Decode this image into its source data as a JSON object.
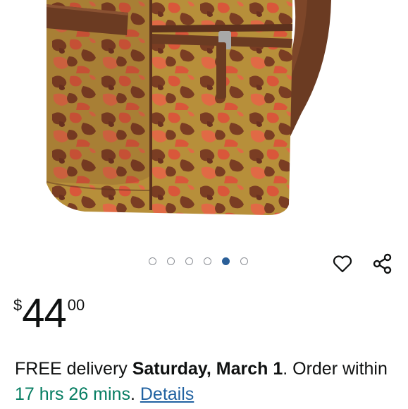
{
  "product": {
    "image_alt": "Leopard print backpack close-up",
    "carousel": {
      "count": 6,
      "active_index": 4
    }
  },
  "actions": {
    "favorite_icon": "heart-outline-icon",
    "share_icon": "share-icon"
  },
  "price": {
    "symbol": "$",
    "whole": "44",
    "fraction": "00"
  },
  "delivery": {
    "prefix": "FREE delivery ",
    "date": "Saturday, March 1",
    "middle": ". Order within ",
    "countdown": "17 hrs 26 mins",
    "after": ". ",
    "link": "Details"
  },
  "colors": {
    "accent_blue": "#2b5f98",
    "link_blue": "#2162a1",
    "countdown_green": "#067d62",
    "strap_brown": "#6b3b22"
  }
}
